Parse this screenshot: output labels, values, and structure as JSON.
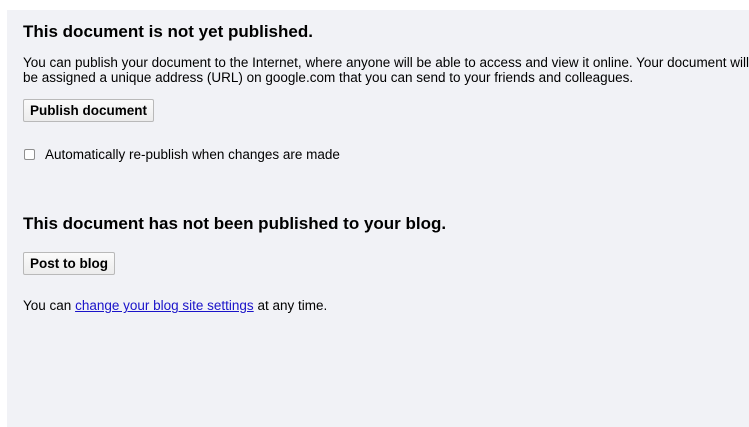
{
  "publish": {
    "heading": "This document is not yet published.",
    "description": "You can publish your document to the Internet, where anyone will be able to access and view it online. Your document will be assigned a unique address (URL) on google.com that you can send to your friends and colleagues.",
    "publish_button": "Publish document",
    "auto_republish_label": "Automatically re-publish when changes are made",
    "auto_republish_checked": false
  },
  "blog": {
    "heading": "This document has not been published to your blog.",
    "post_button": "Post to blog",
    "settings_prefix": "You can ",
    "settings_link": "change your blog site settings",
    "settings_suffix": " at any time."
  },
  "colors": {
    "panel_background": "#f1f2f6",
    "link": "#1a13c9"
  }
}
